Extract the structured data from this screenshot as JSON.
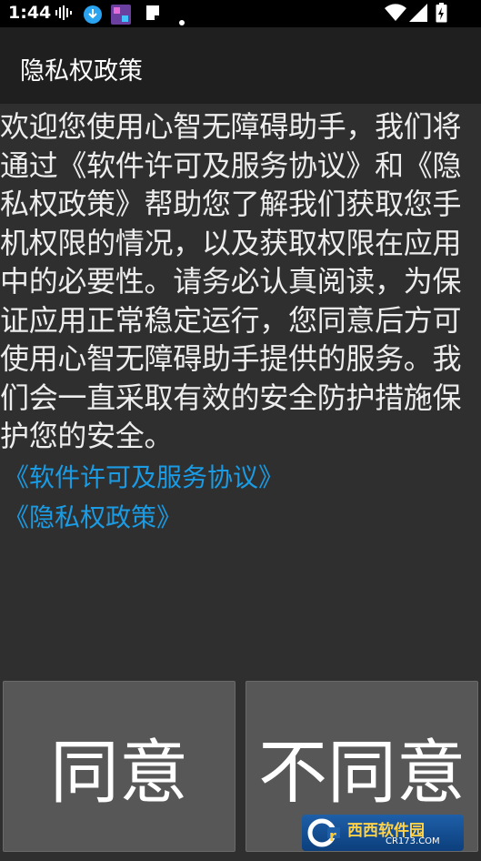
{
  "status_bar": {
    "time": "1:44",
    "left_icons": [
      "waveform-icon",
      "download-icon",
      "app-thumbnail-icon",
      "note-icon",
      "dot-icon"
    ],
    "right_icons": [
      "wifi-icon",
      "signal-icon",
      "battery-charging-icon"
    ]
  },
  "app_bar": {
    "title": "隐私权政策"
  },
  "content": {
    "intro": "欢迎您使用心智无障碍助手，我们将通过《软件许可及服务协议》和《隐私权政策》帮助您了解我们获取您手机权限的情况，以及获取权限在应用中的必要性。请务必认真阅读，为保证应用正常稳定运行，您同意后方可使用心智无障碍助手提供的服务。我们会一直采取有效的安全防护措施保护您的安全。",
    "link_license": "《软件许可及服务协议》",
    "link_privacy": "《隐私权政策》"
  },
  "buttons": {
    "agree": "同意",
    "disagree": "不同意"
  },
  "watermark": {
    "brand": "西西软件园",
    "site": "CR173.COM"
  },
  "colors": {
    "link": "#1a9be3",
    "background": "#2f2f2f",
    "app_bar": "#1f1f1f",
    "button": "#575757"
  }
}
